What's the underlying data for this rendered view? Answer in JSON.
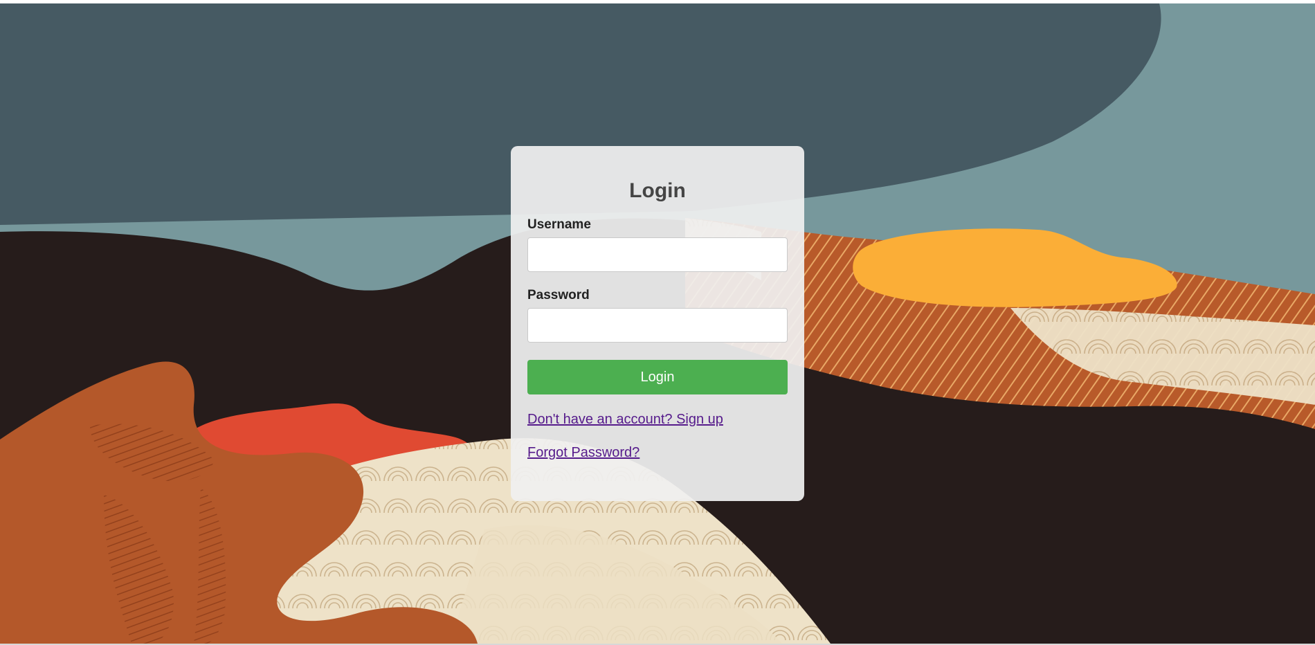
{
  "login": {
    "title": "Login",
    "username_label": "Username",
    "username_value": "",
    "password_label": "Password",
    "password_value": "",
    "button_label": "Login",
    "signup_link": "Don't have an account? Sign up",
    "forgot_link": "Forgot Password?"
  },
  "colors": {
    "button": "#4caf50",
    "link": "#551a8b",
    "card": "#f0f0f0",
    "sky_dark": "#465a63",
    "sky_light": "#77989c",
    "earth_dark": "#261c1b",
    "rust": "#b4582a",
    "sun": "#fbae37",
    "red": "#e04a32",
    "sand": "#ecdfc4"
  },
  "background": {
    "description_icon": "abstract-landscape-illustration"
  }
}
